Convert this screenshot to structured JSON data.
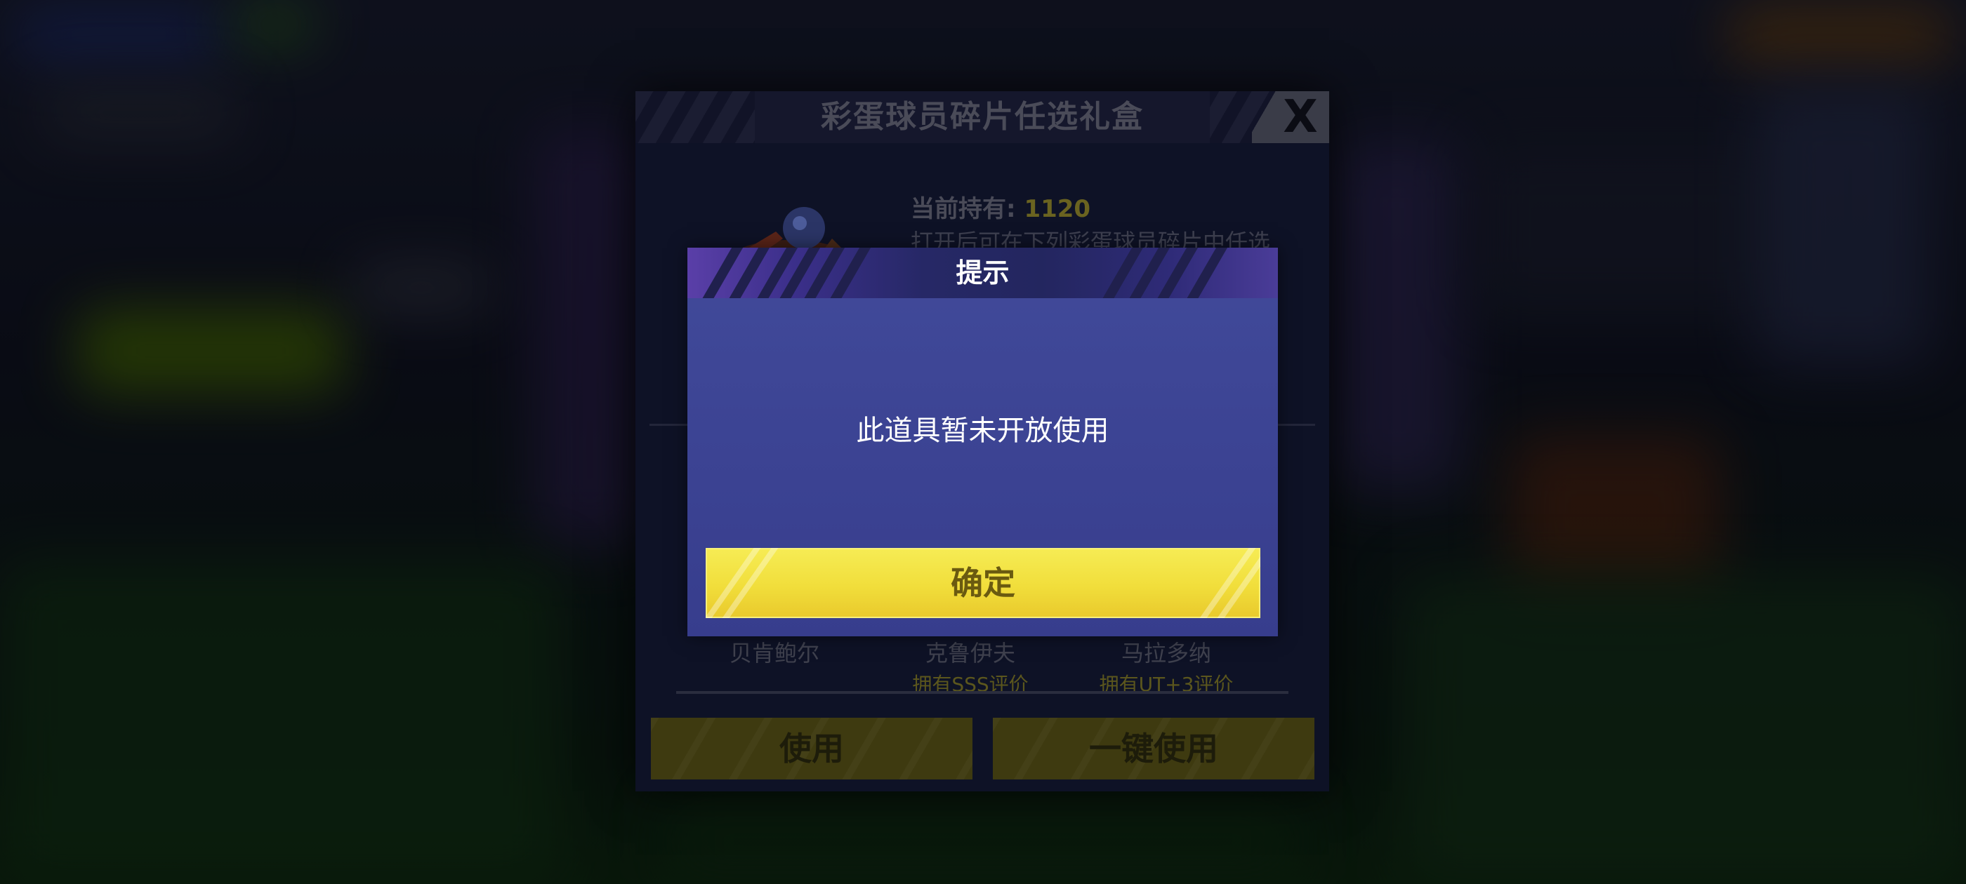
{
  "back_panel": {
    "title": "彩蛋球员碎片任选礼盒",
    "close_label": "X",
    "holding_label": "当前持有:",
    "holding_count": "1120",
    "description": "打开后可在下列彩蛋球员碎片中任选",
    "players": [
      {
        "name": "贝肯鲍尔",
        "rating": ""
      },
      {
        "name": "克鲁伊夫",
        "rating": "拥有SSS评价"
      },
      {
        "name": "马拉多纳",
        "rating": "拥有UT+3评价"
      }
    ],
    "use_button": "使用",
    "use_all_button": "一键使用"
  },
  "dialog": {
    "title": "提示",
    "message": "此道具暂未开放使用",
    "confirm_button": "确定"
  },
  "colors": {
    "dialog_bg": "#3a418f",
    "confirm_yellow": "#f1de3b",
    "holding_highlight": "#6a6320"
  }
}
